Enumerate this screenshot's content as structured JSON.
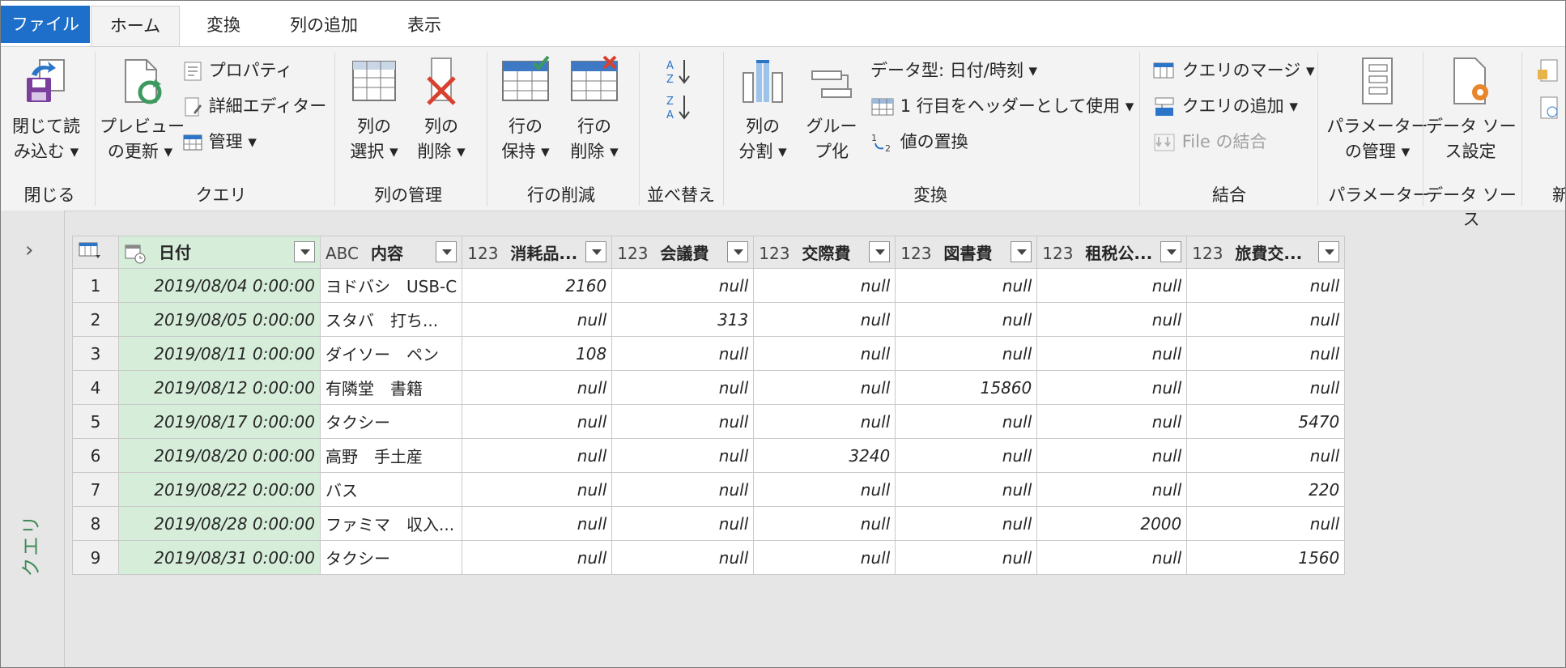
{
  "tabs": [
    {
      "label": "ファイル"
    },
    {
      "label": "ホーム"
    },
    {
      "label": "変換"
    },
    {
      "label": "列の追加"
    },
    {
      "label": "表示"
    }
  ],
  "ribbon": {
    "close_load": {
      "line1": "閉じて読",
      "line2": "み込む ▾"
    },
    "group_close": "閉じる",
    "refresh_preview": {
      "line1": "プレビュー",
      "line2": "の更新 ▾"
    },
    "properties": "プロパティ",
    "advanced_editor": "詳細エディター",
    "manage": "管理 ▾",
    "group_query": "クエリ",
    "choose_columns": {
      "line1": "列の",
      "line2": "選択 ▾"
    },
    "remove_columns": {
      "line1": "列の",
      "line2": "削除 ▾"
    },
    "group_manage_columns": "列の管理",
    "keep_rows": {
      "line1": "行の",
      "line2": "保持 ▾"
    },
    "remove_rows": {
      "line1": "行の",
      "line2": "削除 ▾"
    },
    "group_reduce_rows": "行の削減",
    "group_sort": "並べ替え",
    "split_column": {
      "line1": "列の",
      "line2": "分割 ▾"
    },
    "group_by": {
      "line1": "グルー",
      "line2": "プ化"
    },
    "data_type": "データ型: 日付/時刻 ▾",
    "use_first_row": "1 行目をヘッダーとして使用 ▾",
    "replace_values": "値の置換",
    "group_transform": "変換",
    "merge_queries": "クエリのマージ ▾",
    "append_queries": "クエリの追加 ▾",
    "combine_files": "File の結合",
    "group_combine": "結合",
    "manage_parameters": {
      "line1": "パラメーター",
      "line2": "の管理 ▾"
    },
    "group_parameters": "パラメーター",
    "data_source_settings": {
      "line1": "データ ソー",
      "line2": "ス設定"
    },
    "group_data_sources": "データ ソース",
    "group_new_query_partial": "新"
  },
  "nav": {
    "label": "クエリ"
  },
  "table": {
    "columns": [
      {
        "type": "",
        "name": "日付"
      },
      {
        "type": "ABC",
        "name": "内容"
      },
      {
        "type": "123",
        "name": "消耗品..."
      },
      {
        "type": "123",
        "name": "会議費"
      },
      {
        "type": "123",
        "name": "交際費"
      },
      {
        "type": "123",
        "name": "図書費"
      },
      {
        "type": "123",
        "name": "租税公..."
      },
      {
        "type": "123",
        "name": "旅費交..."
      }
    ],
    "rows": [
      [
        "1",
        "2019/08/04 0:00:00",
        "ヨドバシ　USB-C",
        "2160",
        "null",
        "null",
        "null",
        "null",
        "null"
      ],
      [
        "2",
        "2019/08/05 0:00:00",
        "スタバ　打ち...",
        "null",
        "313",
        "null",
        "null",
        "null",
        "null"
      ],
      [
        "3",
        "2019/08/11 0:00:00",
        "ダイソー　ペン",
        "108",
        "null",
        "null",
        "null",
        "null",
        "null"
      ],
      [
        "4",
        "2019/08/12 0:00:00",
        "有隣堂　書籍",
        "null",
        "null",
        "null",
        "15860",
        "null",
        "null"
      ],
      [
        "5",
        "2019/08/17 0:00:00",
        "タクシー",
        "null",
        "null",
        "null",
        "null",
        "null",
        "5470"
      ],
      [
        "6",
        "2019/08/20 0:00:00",
        "高野　手土産",
        "null",
        "null",
        "3240",
        "null",
        "null",
        "null"
      ],
      [
        "7",
        "2019/08/22 0:00:00",
        "バス",
        "null",
        "null",
        "null",
        "null",
        "null",
        "220"
      ],
      [
        "8",
        "2019/08/28 0:00:00",
        "ファミマ　収入...",
        "null",
        "null",
        "null",
        "null",
        "2000",
        "null"
      ],
      [
        "9",
        "2019/08/31 0:00:00",
        "タクシー",
        "null",
        "null",
        "null",
        "null",
        "null",
        "1560"
      ]
    ]
  }
}
